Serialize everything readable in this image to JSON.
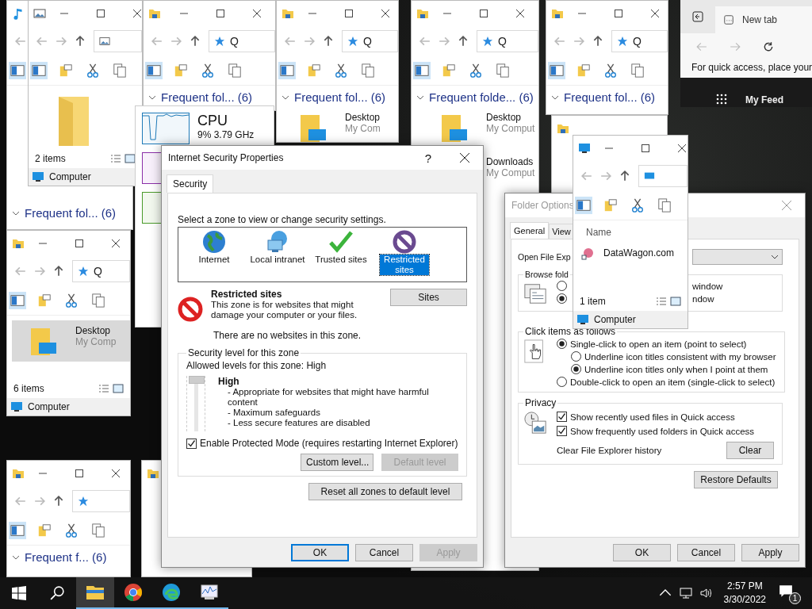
{
  "explorers": [
    {
      "item_count": "2 items",
      "location": "Computer"
    },
    {
      "heading": "Frequent fol... (6)"
    },
    {
      "address": "Q",
      "heading": "Frequent fol... (6)"
    },
    {
      "address": "Q",
      "heading": "Frequent fol... (6)",
      "entries": [
        {
          "kind": "desktop",
          "name": "Desktop",
          "sub": "My Com",
          "selected": false
        }
      ]
    },
    {
      "address": "Q",
      "heading": "Frequent folde... (6)",
      "entries": [
        {
          "kind": "desktop",
          "name": "Desktop",
          "sub": "My Comput",
          "selected": false
        },
        {
          "kind": "downloads",
          "name": "Downloads",
          "sub": "My Comput",
          "selected": false
        }
      ]
    },
    {
      "address": "Q",
      "heading": "Frequent fol... (6)"
    },
    {
      "address": "Q",
      "entries": [
        {
          "kind": "desktop",
          "name": "Desktop",
          "sub": "My Comp",
          "selected": true
        }
      ],
      "item_count": "6 items",
      "location": "Computer"
    },
    {
      "heading": "Frequent f... (6)"
    },
    {
      "column": "Name",
      "entries": [
        {
          "kind": "site",
          "name": "DataWagon.com",
          "selected": false
        }
      ],
      "item_count": "1 item",
      "location": "Computer"
    }
  ],
  "task_manager": {
    "title": "CPU",
    "reading": "9% 3.79 GHz"
  },
  "browser": {
    "tab": "New tab",
    "hint": "For quick access, place your",
    "feed": "My Feed"
  },
  "internet_security": {
    "title": "Internet Security Properties",
    "help": "?",
    "tabs": [
      {
        "label": "Security",
        "selected": true
      }
    ],
    "prompt": "Select a zone to view or change security settings.",
    "zones": [
      {
        "kind": "internet",
        "label": "Internet",
        "selected": false
      },
      {
        "kind": "intranet",
        "label": "Local intranet",
        "selected": false
      },
      {
        "kind": "trusted",
        "label": "Trusted sites",
        "selected": false
      },
      {
        "kind": "restricted",
        "label": "Restricted sites",
        "selected": true
      }
    ],
    "zone_title": "Restricted sites",
    "zone_description": "This zone is for websites that might damage your computer or your files.",
    "sites_button": "Sites",
    "zone_note": "There are no websites in this zone.",
    "level_group": "Security level for this zone",
    "allowed": "Allowed levels for this zone: High",
    "level": 1,
    "level_name": "High",
    "level_points": [
      "- Appropriate for websites that might have harmful content",
      "- Maximum safeguards",
      "- Less secure features are disabled"
    ],
    "protected_mode": {
      "label": "Enable Protected Mode (requires restarting Internet Explorer)",
      "checked": true
    },
    "custom_button": {
      "label": "Custom level...",
      "disabled": false
    },
    "default_button": {
      "label": "Default level",
      "disabled": true
    },
    "reset_button": "Reset all zones to default level",
    "buttons": [
      {
        "label": "OK",
        "focused": true,
        "disabled": false
      },
      {
        "label": "Cancel",
        "focused": false,
        "disabled": false
      },
      {
        "label": "Apply",
        "focused": false,
        "disabled": true
      }
    ]
  },
  "folder_options": {
    "title": "Folder Options",
    "active": false,
    "tabs": [
      {
        "label": "General",
        "selected": true
      },
      {
        "label": "View",
        "selected": false
      }
    ],
    "open_label": "Open File Exp",
    "browse_group": "Browse fold",
    "browse_options": [
      {
        "label": "window",
        "selected": false
      },
      {
        "label": "ndow",
        "selected": true
      }
    ],
    "click_group": "Click items as follows",
    "click_options": [
      {
        "label": "Single-click to open an item (point to select)",
        "selected": true,
        "children": [
          {
            "label": "Underline icon titles consistent with my browser",
            "selected": false
          },
          {
            "label": "Underline icon titles only when I point at them",
            "selected": true
          }
        ]
      },
      {
        "label": "Double-click to open an item (single-click to select)",
        "selected": false
      }
    ],
    "privacy_group": "Privacy",
    "privacy_checks": [
      {
        "label": "Show recently used files in Quick access",
        "checked": true
      },
      {
        "label": "Show frequently used folders in Quick access",
        "checked": true
      }
    ],
    "clear_label": "Clear File Explorer history",
    "clear_button": "Clear",
    "restore_button": "Restore Defaults",
    "buttons": [
      {
        "label": "OK",
        "focused": false,
        "disabled": false
      },
      {
        "label": "Cancel",
        "focused": false,
        "disabled": false
      },
      {
        "label": "Apply",
        "focused": false,
        "disabled": false
      }
    ]
  },
  "taskbar": {
    "apps": [
      {
        "kind": "explorer",
        "active": true
      },
      {
        "kind": "chrome",
        "active": false
      },
      {
        "kind": "edge",
        "active": false
      },
      {
        "kind": "monitor",
        "active": false
      }
    ],
    "time": "2:57 PM",
    "date": "3/30/2022",
    "notifications": "1"
  }
}
